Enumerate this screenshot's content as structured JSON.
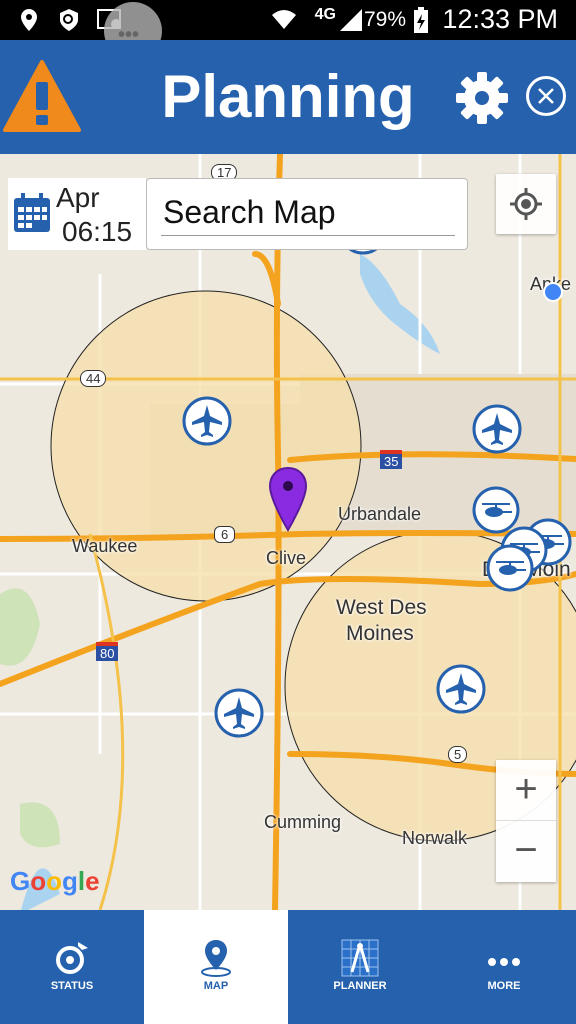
{
  "status_bar": {
    "time": "12:33 PM",
    "battery": "79%",
    "network": "4G"
  },
  "header": {
    "title": "Planning"
  },
  "date": {
    "month": "Apr",
    "time": "06:15"
  },
  "search": {
    "placeholder": "Search Map"
  },
  "map_labels": {
    "urbandale": "Urbandale",
    "waukee": "Waukee",
    "clive": "Clive",
    "west_des_moines_1": "West Des",
    "west_des_moines_2": "Moines",
    "cumming": "Cumming",
    "norwalk": "Norwalk",
    "des_moines": "Des Moin",
    "ankeny": "Anke",
    "hwy_17": "17",
    "hwy_44": "44",
    "hwy_35": "35",
    "hwy_6": "6",
    "hwy_80": "80",
    "hwy_5": "5"
  },
  "zoom": {
    "in": "+",
    "out": "−"
  },
  "attribution": "Google",
  "tabs": [
    {
      "label": "STATUS"
    },
    {
      "label": "MAP"
    },
    {
      "label": "PLANNER"
    },
    {
      "label": "MORE"
    }
  ],
  "colors": {
    "header": "#2561ad",
    "warning": "#f08a1c",
    "zone_fill": "#f5deaa",
    "marker": "#8a2be2"
  }
}
